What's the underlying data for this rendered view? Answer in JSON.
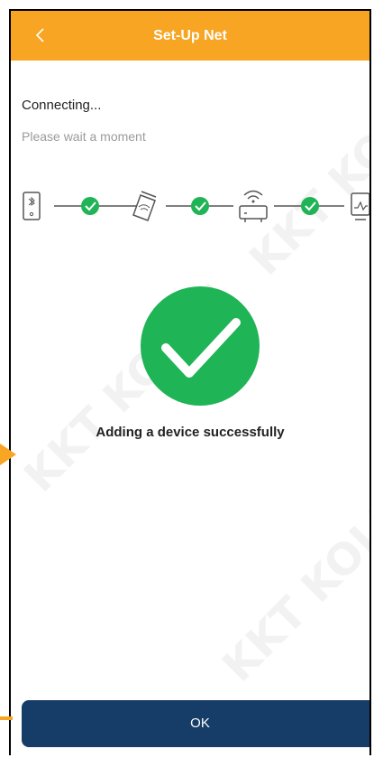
{
  "header": {
    "title": "Set-Up Net",
    "back_icon": "chevron-left-icon",
    "color": "#f7a523"
  },
  "status": {
    "connecting": "Connecting...",
    "wait": "Please wait a moment"
  },
  "steps": {
    "icons": [
      "bluetooth-device-icon",
      "wifi-card-icon",
      "router-icon",
      "monitor-icon"
    ],
    "checks_complete": 3,
    "check_color": "#1fb455"
  },
  "result": {
    "message": "Adding a device successfully",
    "icon": "success-check-icon"
  },
  "ok_button": {
    "label": "OK",
    "color": "#163d67"
  },
  "watermark": "KKT KOLBE"
}
